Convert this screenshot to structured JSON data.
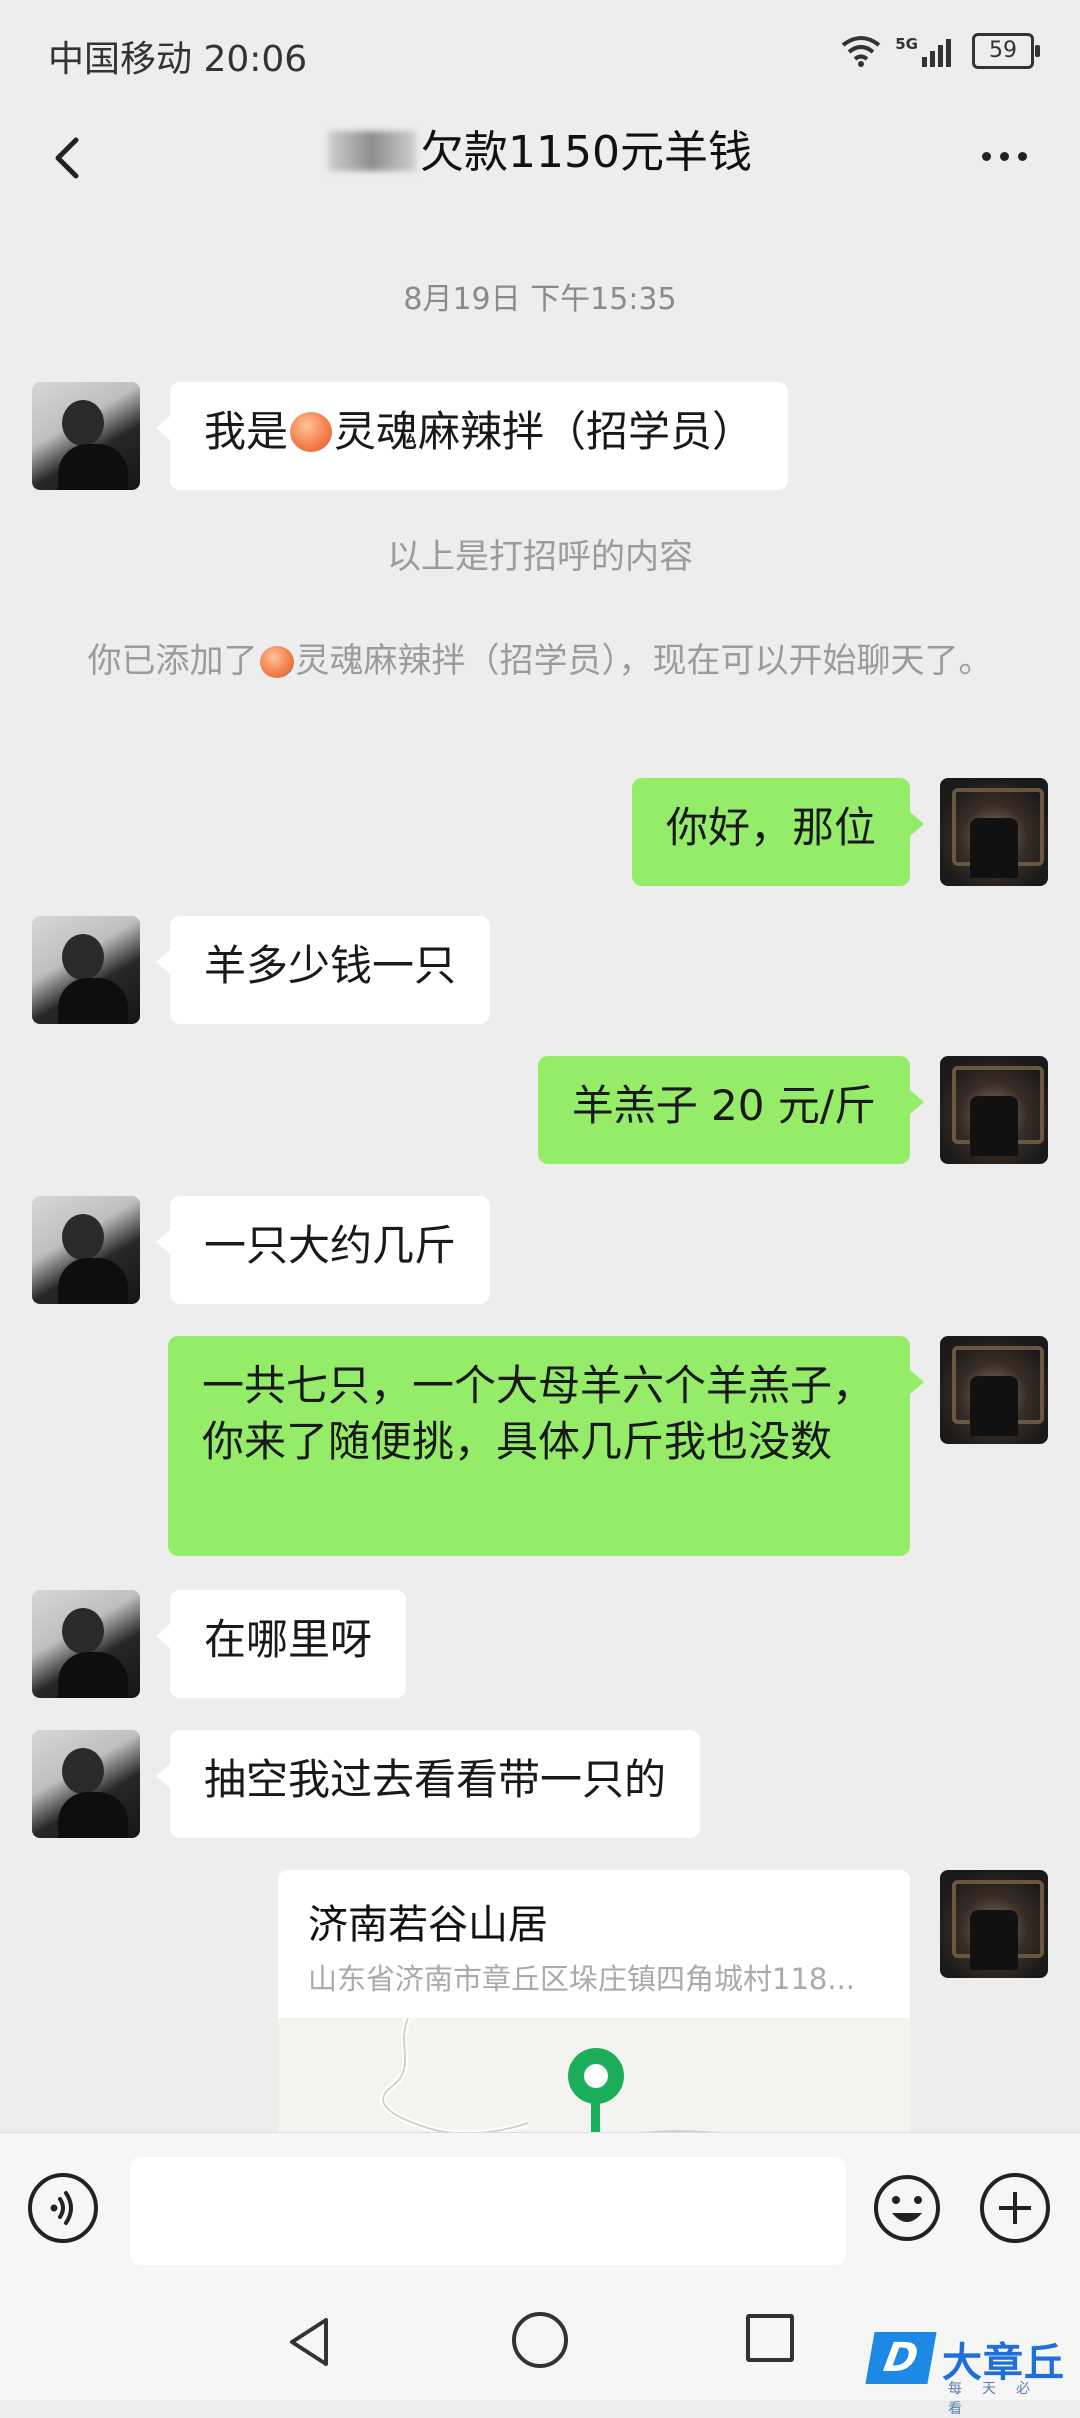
{
  "status_bar": {
    "carrier": "中国移动",
    "time": "20:06",
    "network": "5G",
    "battery": "59"
  },
  "header": {
    "title": "欠款1150元羊钱"
  },
  "chat": {
    "timestamp": "8月19日 下午15:35",
    "greeting_note": "以上是打招呼的内容",
    "added_note_before": "你已添加了",
    "added_note_after": "灵魂麻辣拌（招学员），现在可以开始聊天了。",
    "messages": [
      {
        "side": "left",
        "prefix": "我是",
        "text": "灵魂麻辣拌（招学员）"
      },
      {
        "side": "right",
        "text": "你好，那位"
      },
      {
        "side": "left",
        "text": "羊多少钱一只"
      },
      {
        "side": "right",
        "text": "羊羔子 20 元/斤"
      },
      {
        "side": "left",
        "text": "一只大约几斤"
      },
      {
        "side": "right",
        "text": "一共七只，一个大母羊六个羊羔子，你来了随便挑，具体几斤我也没数"
      },
      {
        "side": "left",
        "text": "在哪里呀"
      },
      {
        "side": "left",
        "text": "抽空我过去看看带一只的"
      }
    ],
    "location": {
      "name": "济南若谷山居",
      "address": "山东省济南市章丘区垛庄镇四角城村118..."
    }
  },
  "watermark": {
    "badge": "D",
    "name": "大章丘",
    "slogan": "每天必看"
  },
  "colors": {
    "background": "#ededed",
    "own_bubble": "#95ec69",
    "other_bubble": "#ffffff",
    "pin": "#1aad5a"
  }
}
